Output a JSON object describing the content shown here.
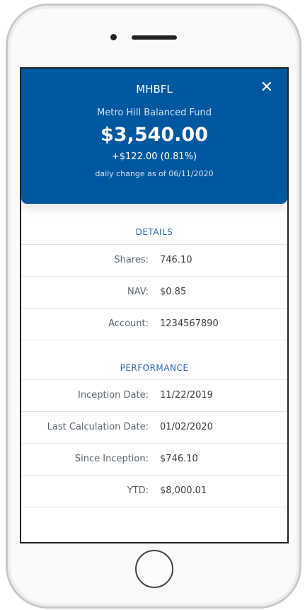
{
  "header": {
    "ticker": "MHBFL",
    "fund_name": "Metro Hill Balanced Fund",
    "value": "$3,540.00",
    "change": "+$122.00 (0.81%)",
    "as_of": "daily change as of 06/11/2020",
    "close_icon": "close-icon",
    "close_glyph": "✕",
    "color": "#0058a0"
  },
  "details": {
    "title": "DETAILS",
    "rows": [
      {
        "label": "Shares:",
        "value": "746.10"
      },
      {
        "label": "NAV:",
        "value": "$0.85"
      },
      {
        "label": "Account:",
        "value": "1234567890"
      }
    ]
  },
  "performance": {
    "title": "PERFORMANCE",
    "rows": [
      {
        "label": "Inception Date:",
        "value": "11/22/2019"
      },
      {
        "label": "Last Calculation Date:",
        "value": "01/02/2020"
      },
      {
        "label": "Since Inception:",
        "value": "$746.10"
      },
      {
        "label": "YTD:",
        "value": "$8,000.01"
      }
    ]
  }
}
